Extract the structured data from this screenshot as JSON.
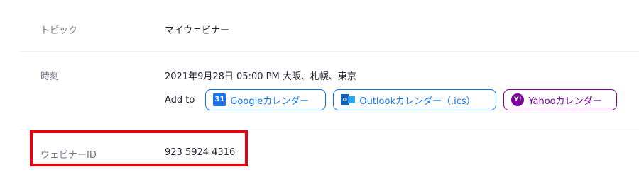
{
  "topic": {
    "label": "トピック",
    "value": "マイウェビナー"
  },
  "time": {
    "label": "時刻",
    "value": "2021年9月28日 05:00 PM 大阪、札幌、東京",
    "add_to_label": "Add to",
    "calendars": [
      {
        "name": "Googleカレンダー",
        "icon": "google-calendar-icon",
        "icon_text": "31",
        "color": "#0e72ed"
      },
      {
        "name": "Outlookカレンダー（.ics）",
        "icon": "outlook-icon",
        "icon_text": "o",
        "color": "#0e72ed"
      },
      {
        "name": "Yahooカレンダー",
        "icon": "yahoo-icon",
        "icon_text": "Y!",
        "color": "#7b0099"
      }
    ]
  },
  "webinar_id": {
    "label": "ウェビナーID",
    "value": "923 5924 4316"
  },
  "colors": {
    "highlight": "#e8000f",
    "link_blue": "#0e72ed",
    "yahoo_purple": "#7b0099",
    "label_gray": "#747487"
  }
}
